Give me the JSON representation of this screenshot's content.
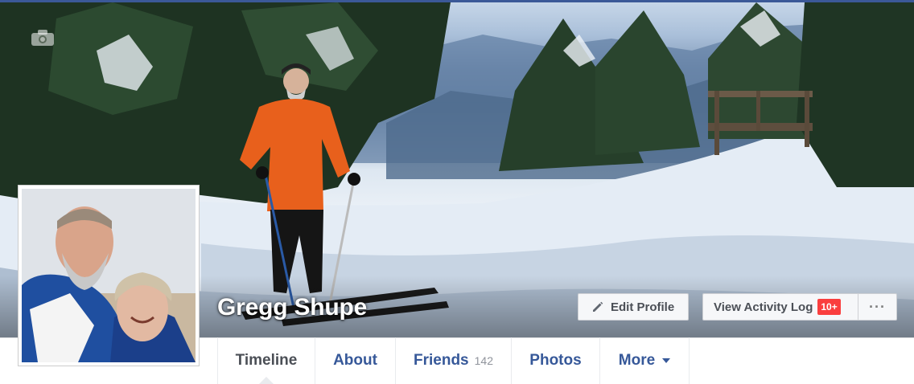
{
  "profile": {
    "name": "Gregg Shupe"
  },
  "actions": {
    "edit_profile": "Edit Profile",
    "view_activity_log": "View Activity Log",
    "activity_badge": "10+",
    "more_options": "···"
  },
  "tabs": [
    {
      "label": "Timeline"
    },
    {
      "label": "About"
    },
    {
      "label": "Friends",
      "count": "142"
    },
    {
      "label": "Photos"
    },
    {
      "label": "More"
    }
  ],
  "icons": {
    "cover_photo": "camera-icon",
    "edit": "pencil-icon",
    "more_dropdown": "caret-down-icon"
  },
  "colors": {
    "link": "#365899",
    "badge": "#fa3e3e",
    "brand_bar": "#3b5998"
  }
}
